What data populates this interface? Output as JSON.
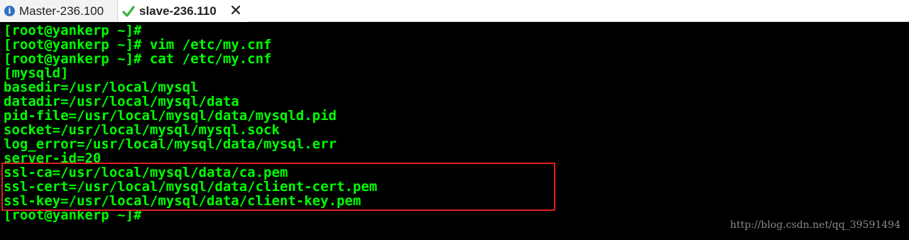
{
  "tabs": [
    {
      "label": "Master-236.100",
      "icon": "info-icon",
      "active": false
    },
    {
      "label": "slave-236.110",
      "icon": "check-icon",
      "active": true
    }
  ],
  "terminal": {
    "lines": [
      "[root@yankerp ~]#",
      "[root@yankerp ~]# vim /etc/my.cnf",
      "[root@yankerp ~]# cat /etc/my.cnf",
      "[mysqld]",
      "basedir=/usr/local/mysql",
      "datadir=/usr/local/mysql/data",
      "pid-file=/usr/local/mysql/data/mysqld.pid",
      "socket=/usr/local/mysql/mysql.sock",
      "log_error=/usr/local/mysql/data/mysql.err",
      "server-id=20",
      "ssl-ca=/usr/local/mysql/data/ca.pem",
      "ssl-cert=/usr/local/mysql/data/client-cert.pem",
      "ssl-key=/usr/local/mysql/data/client-key.pem",
      "[root@yankerp ~]#"
    ],
    "text_color": "#00ff00",
    "background_color": "#000000",
    "highlight_color": "#e02020"
  },
  "watermark": "http://blog.csdn.net/qq_39591494"
}
